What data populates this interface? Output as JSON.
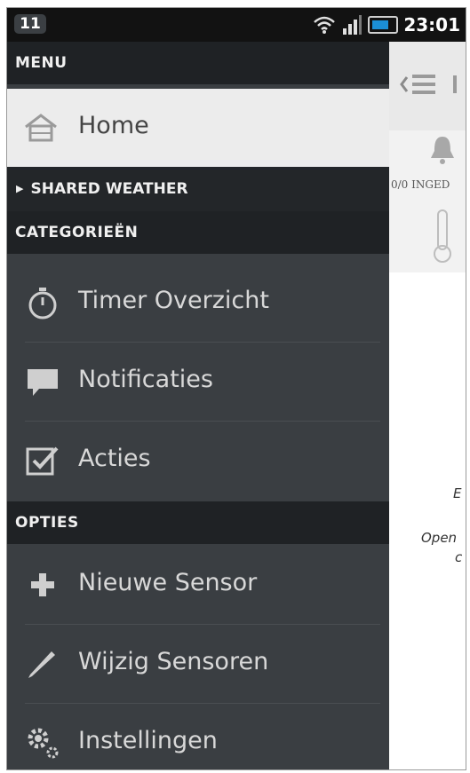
{
  "status_bar": {
    "notification_count": "11",
    "time": "23:01",
    "icons": [
      "wifi-icon",
      "signal-icon",
      "battery-icon"
    ]
  },
  "drawer": {
    "menu_header": "MENU",
    "home_label": "Home",
    "shared_weather": "SHARED WEATHER",
    "categories_header": "CATEGORIEËN",
    "category_items": [
      {
        "label": "Timer Overzicht",
        "icon": "stopwatch-icon"
      },
      {
        "label": "Notificaties",
        "icon": "speech-bubble-icon"
      },
      {
        "label": "Acties",
        "icon": "checkbox-icon"
      }
    ],
    "options_header": "OPTIES",
    "option_items": [
      {
        "label": "Nieuwe Sensor",
        "icon": "plus-icon"
      },
      {
        "label": "Wijzig Sensoren",
        "icon": "pencil-icon"
      },
      {
        "label": "Instellingen",
        "icon": "gears-icon"
      }
    ]
  },
  "content": {
    "tile_caption": "0/0 INGED",
    "fragment_1": "E",
    "fragment_2": "Open",
    "fragment_3": "c"
  },
  "colors": {
    "drawer_bg": "#3a3e42",
    "header_bg": "#1f2225",
    "selected_bg": "#ececec",
    "accent_battery": "#1b8fd6"
  }
}
